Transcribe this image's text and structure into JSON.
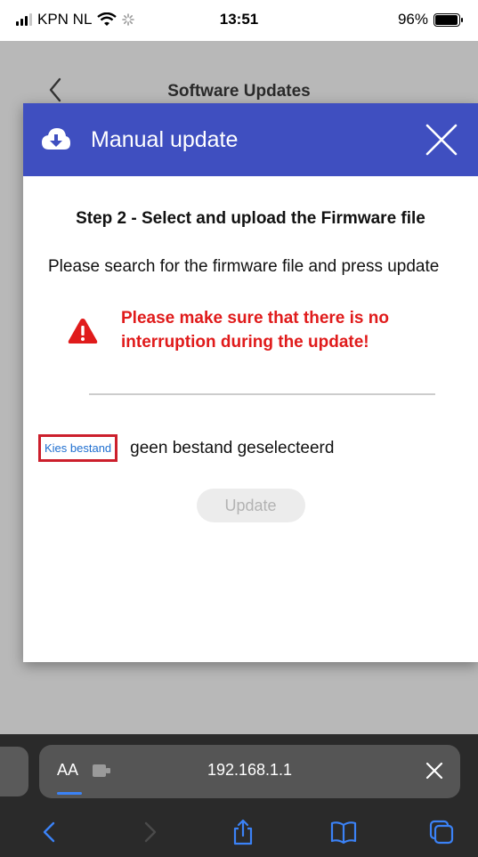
{
  "status_bar": {
    "carrier": "KPN NL",
    "time": "13:51",
    "battery": "96%",
    "battery_level": 0.96
  },
  "page": {
    "title": "Software Updates"
  },
  "modal": {
    "title": "Manual update",
    "step_title": "Step 2 - Select and upload the Firmware file",
    "description": "Please search for the firmware file and press update",
    "warning": "Please make sure that there is no interruption during the update!",
    "file_button": "Kies bestand",
    "file_status": "geen bestand geselecteerd",
    "update_button": "Update"
  },
  "browser": {
    "text_size_label": "AA",
    "url": "192.168.1.1"
  },
  "colors": {
    "header_bg": "#3f4fc0",
    "warning": "#e01b1b",
    "link": "#1f6fd0",
    "highlight_border": "#cc1f2c"
  },
  "icons": [
    "signal-icon",
    "wifi-icon",
    "loading-icon",
    "battery-icon",
    "back-chevron-icon",
    "cloud-download-icon",
    "close-icon",
    "warning-icon",
    "extension-icon",
    "nav-back-icon",
    "nav-forward-icon",
    "share-icon",
    "bookmarks-icon",
    "tabs-icon"
  ]
}
